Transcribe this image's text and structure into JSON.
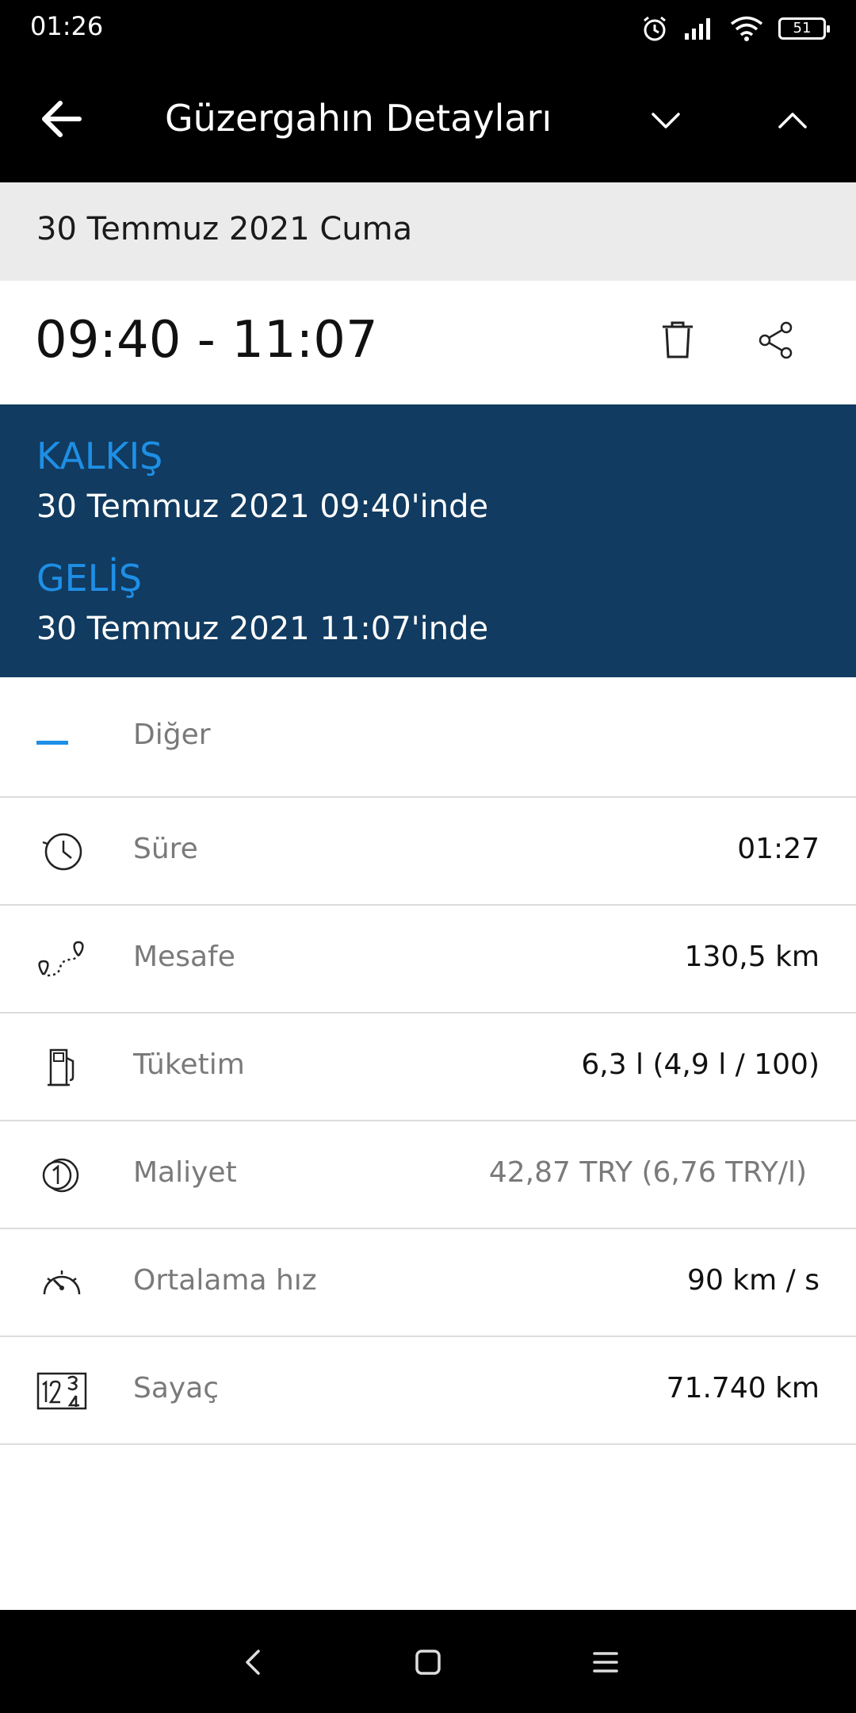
{
  "status_bar": {
    "time": "01:26",
    "battery": "51",
    "icons": [
      "alarm-icon",
      "signal-icon",
      "wifi-icon",
      "battery-icon"
    ]
  },
  "app_bar": {
    "title": "Güzergahın Detayları",
    "back_icon": "arrow-left-icon",
    "prev_icon": "chevron-down-icon",
    "next_icon": "chevron-up-icon"
  },
  "date": "30 Temmuz 2021 Cuma",
  "time_range": "09:40 - 11:07",
  "actions": {
    "delete_icon": "trash-icon",
    "share_icon": "share-icon"
  },
  "trip": {
    "departure_label": "KALKIŞ",
    "departure_value": "30 Temmuz 2021 09:40'inde",
    "arrival_label": "GELİŞ",
    "arrival_value": "30 Temmuz 2021 11:07'inde"
  },
  "details": {
    "category": {
      "label": "Diğer",
      "icon": "dash-icon"
    },
    "rows": [
      {
        "label": "Süre",
        "value": "01:27",
        "icon": "clock-icon"
      },
      {
        "label": "Mesafe",
        "value": "130,5 km",
        "icon": "route-icon"
      },
      {
        "label": "Tüketim",
        "value": "6,3 l (4,9 l / 100)",
        "icon": "fuel-pump-icon"
      },
      {
        "label": "Maliyet",
        "value": "42,87 TRY (6,76 TRY/l)",
        "icon": "coins-icon"
      },
      {
        "label": "Ortalama hız",
        "value": "90 km / s",
        "icon": "speedometer-icon"
      },
      {
        "label": "Sayaç",
        "value": "71.740 km",
        "icon": "odometer-icon"
      }
    ]
  },
  "colors": {
    "panel_bg": "#113b60",
    "accent_blue": "#1e8fe6",
    "bar_bg": "#000000",
    "date_band_bg": "#ebebeb"
  },
  "nav_bar": {
    "icons": [
      "nav-back-icon",
      "nav-home-icon",
      "nav-menu-icon"
    ]
  }
}
